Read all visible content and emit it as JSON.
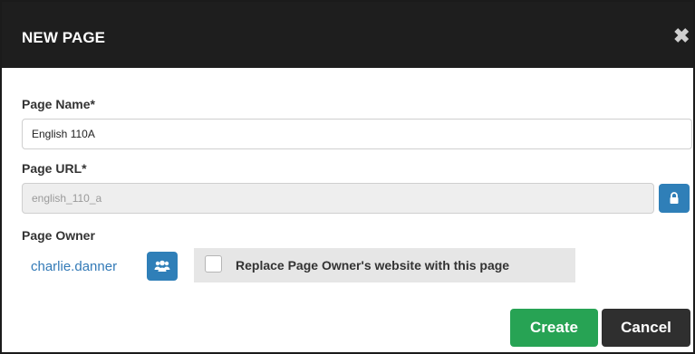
{
  "dialog": {
    "title": "NEW PAGE",
    "close_glyph": "✖"
  },
  "form": {
    "page_name": {
      "label": "Page Name*",
      "value": "English 110A"
    },
    "page_url": {
      "label": "Page URL*",
      "value": "english_110_a",
      "lock_icon": "lock-icon"
    },
    "page_owner": {
      "label": "Page Owner",
      "owner_name": "charlie.danner",
      "users_icon": "users-icon"
    },
    "replace_website": {
      "label": "Replace Page Owner's website with this page",
      "checked": false
    }
  },
  "actions": {
    "create_label": "Create",
    "cancel_label": "Cancel"
  },
  "colors": {
    "header_bg": "#1e1e1e",
    "primary_blue": "#2f7fb8",
    "link_blue": "#337ab7",
    "create_green": "#27a354",
    "cancel_dark": "#2f2f2f"
  }
}
